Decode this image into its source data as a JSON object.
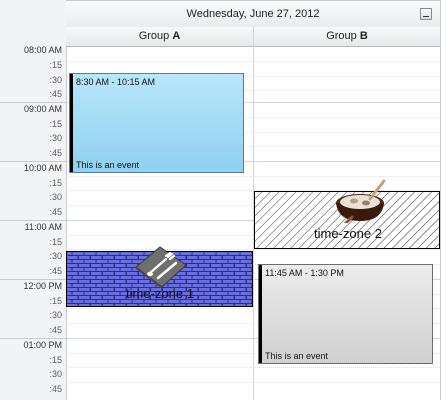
{
  "header": {
    "date": "Wednesday, June 27, 2012"
  },
  "groups": [
    {
      "label_plain": "Group ",
      "label_bold": "A"
    },
    {
      "label_plain": "Group ",
      "label_bold": "B"
    }
  ],
  "time_labels": {
    "r0": "08:00 AM",
    "r1": ":15",
    "r2": ":30",
    "r3": ":45",
    "r4": "09:00 AM",
    "r5": ":15",
    "r6": ":30",
    "r7": ":45",
    "r8": "10:00 AM",
    "r9": ":15",
    "r10": ":30",
    "r11": ":45",
    "r12": "11:00 AM",
    "r13": ":15",
    "r14": ":30",
    "r15": ":45",
    "r16": "12:00 PM",
    "r17": ":15",
    "r18": ":30",
    "r19": ":45",
    "r20": "01:00 PM",
    "r21": ":15",
    "r22": ":30",
    "r23": ":45"
  },
  "events": {
    "a": {
      "time": "8:30 AM - 10:15 AM",
      "text": "This is an event",
      "color": "#9fd8f4"
    },
    "b": {
      "time": "11:45 AM - 1:30 PM",
      "text": "This is an event",
      "color": "#d9d9d9"
    }
  },
  "time_zones": {
    "zone1": {
      "label": "time-zone 1",
      "icon": "fork-knife-icon",
      "color": "#6a6fe0"
    },
    "zone2": {
      "label": "time-zone 2",
      "icon": "cooking-pot-icon"
    }
  }
}
